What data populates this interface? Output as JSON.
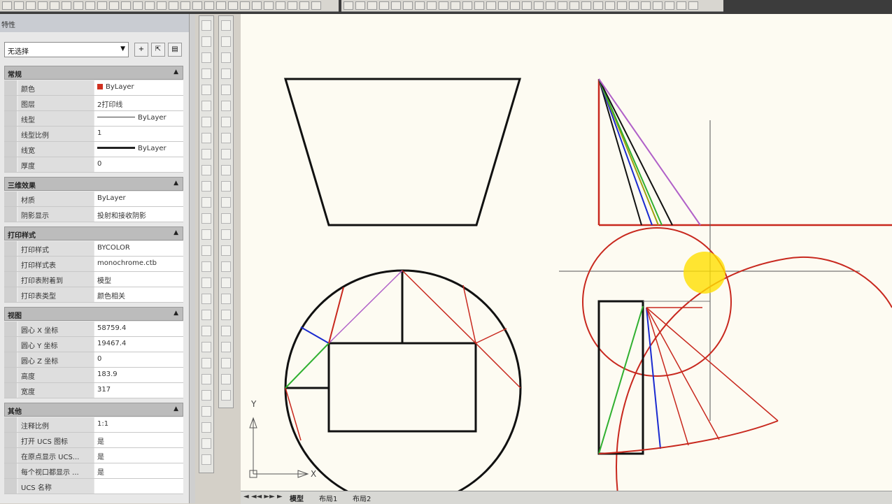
{
  "palette": {
    "title": "特性",
    "selection": "无选择",
    "sections": [
      {
        "title": "常规",
        "rows": [
          {
            "key": "颜色",
            "value": "ByLayer",
            "kind": "color"
          },
          {
            "key": "图层",
            "value": "2打印线",
            "kind": "text"
          },
          {
            "key": "线型",
            "value": "ByLayer",
            "kind": "line"
          },
          {
            "key": "线型比例",
            "value": "1",
            "kind": "text"
          },
          {
            "key": "线宽",
            "value": "ByLayer",
            "kind": "thick"
          },
          {
            "key": "厚度",
            "value": "0",
            "kind": "text"
          }
        ]
      },
      {
        "title": "三维效果",
        "rows": [
          {
            "key": "材质",
            "value": "ByLayer",
            "kind": "text"
          },
          {
            "key": "阴影显示",
            "value": "投射和接收阴影",
            "kind": "text"
          }
        ]
      },
      {
        "title": "打印样式",
        "rows": [
          {
            "key": "打印样式",
            "value": "BYCOLOR",
            "kind": "text"
          },
          {
            "key": "打印样式表",
            "value": "monochrome.ctb",
            "kind": "text"
          },
          {
            "key": "打印表附着到",
            "value": "模型",
            "kind": "text"
          },
          {
            "key": "打印表类型",
            "value": "颜色相关",
            "kind": "text"
          }
        ]
      },
      {
        "title": "视图",
        "rows": [
          {
            "key": "圆心 X 坐标",
            "value": "58759.4",
            "kind": "text"
          },
          {
            "key": "圆心 Y 坐标",
            "value": "19467.4",
            "kind": "text"
          },
          {
            "key": "圆心 Z 坐标",
            "value": "0",
            "kind": "text"
          },
          {
            "key": "高度",
            "value": "183.9",
            "kind": "text"
          },
          {
            "key": "宽度",
            "value": "317",
            "kind": "text"
          }
        ]
      },
      {
        "title": "其他",
        "rows": [
          {
            "key": "注释比例",
            "value": "1:1",
            "kind": "text"
          },
          {
            "key": "打开 UCS 图标",
            "value": "是",
            "kind": "text"
          },
          {
            "key": "在原点显示 UCS...",
            "value": "是",
            "kind": "text"
          },
          {
            "key": "每个视口都显示 ...",
            "value": "是",
            "kind": "text"
          },
          {
            "key": "UCS 名称",
            "value": "",
            "kind": "text"
          }
        ]
      }
    ]
  },
  "ucs": {
    "y": "Y",
    "x": "X"
  },
  "tabs": [
    "模型",
    "布局1",
    "布局2"
  ],
  "colors": {
    "red": "#c8281e",
    "black": "#111111",
    "purple": "#b060c8",
    "blue": "#1a2ad0",
    "green": "#30b030",
    "olive": "#a0a010",
    "highlight": "#ffe000"
  }
}
